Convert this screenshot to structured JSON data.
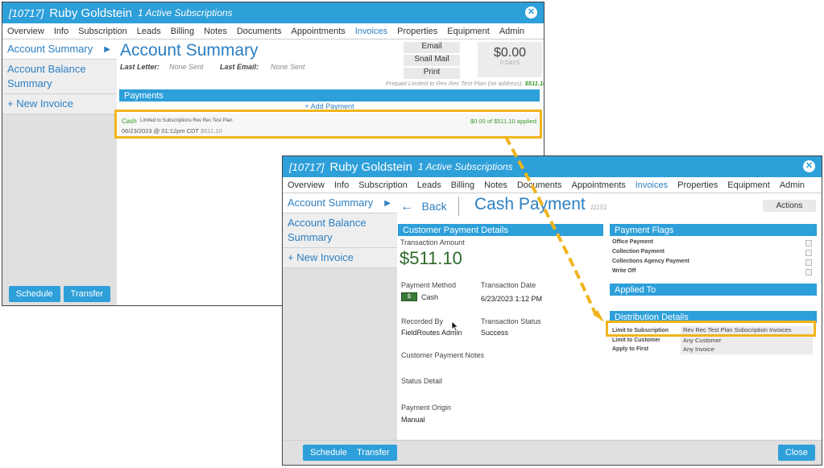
{
  "header": {
    "customer_id": "[10717]",
    "customer_name": "Ruby Goldstein",
    "subscriptions": "1 Active Subscriptions"
  },
  "tabs": [
    "Overview",
    "Info",
    "Subscription",
    "Leads",
    "Billing",
    "Notes",
    "Documents",
    "Appointments",
    "Invoices",
    "Properties",
    "Equipment",
    "Admin"
  ],
  "sidebar": {
    "items": [
      {
        "label": "Account Summary"
      },
      {
        "label": "Account Balance Summary"
      },
      {
        "label": "+ New Invoice"
      }
    ]
  },
  "footer": {
    "schedule": "Schedule",
    "transfer": "Transfer",
    "close": "Close"
  },
  "account_summary": {
    "title": "Account Summary",
    "last_letter_label": "Last Letter:",
    "last_letter_value": "None Sent",
    "last_email_label": "Last Email:",
    "last_email_value": "None Sent",
    "email_btn": "Email",
    "snail_mail_btn": "Snail Mail",
    "print_btn": "Print",
    "balance": "$0.00",
    "balance_days": "0 DAYS",
    "prepaid_text": "Prepaid Limited to Rev Rec Test Plan (no address):",
    "prepaid_amount": "$511.10",
    "payments_header": "Payments",
    "add_payment": "+ Add Payment",
    "payment": {
      "method": "Cash",
      "limit_text": "Limited to Subscriptions Rev Rec Test Plan",
      "datetime": "06/23/2023 @ 01:12pm CDT",
      "amount": "$511.10",
      "applied": "$0.00 of $511.10 applied"
    }
  },
  "cash_payment": {
    "back": "Back",
    "title": "Cash Payment",
    "payment_id": "11151",
    "actions": "Actions",
    "details_header": "Customer Payment Details",
    "transaction_amount_label": "Transaction Amount",
    "transaction_amount": "$511.10",
    "payment_method_label": "Payment Method",
    "payment_method_value": "Cash",
    "transaction_date_label": "Transaction Date",
    "transaction_date_value": "6/23/2023 1:12 PM",
    "recorded_by_label": "Recorded By",
    "recorded_by_value": "FieldRoutes Admin",
    "transaction_status_label": "Transaction Status",
    "transaction_status_value": "Success",
    "notes_label": "Customer Payment Notes",
    "status_detail_label": "Status Detail",
    "payment_origin_label": "Payment Origin",
    "payment_origin_value": "Manual",
    "flags_header": "Payment Flags",
    "flags": [
      "Office Payment",
      "Collection Payment",
      "Collections Agency Payment",
      "Write Off"
    ],
    "applied_to_header": "Applied To",
    "distribution_header": "Distribution Details",
    "distribution": [
      {
        "label": "Limit to Subscription",
        "value": "Rev Rec Test Plan Subscription Invoices"
      },
      {
        "label": "Limit to Customer",
        "value": "Any Customer"
      },
      {
        "label": "Apply to First",
        "value": "Any Invoice"
      }
    ]
  },
  "colors": {
    "accent": "#2d9fd9",
    "highlight": "#f0b41c",
    "green": "#3a9a2e"
  }
}
